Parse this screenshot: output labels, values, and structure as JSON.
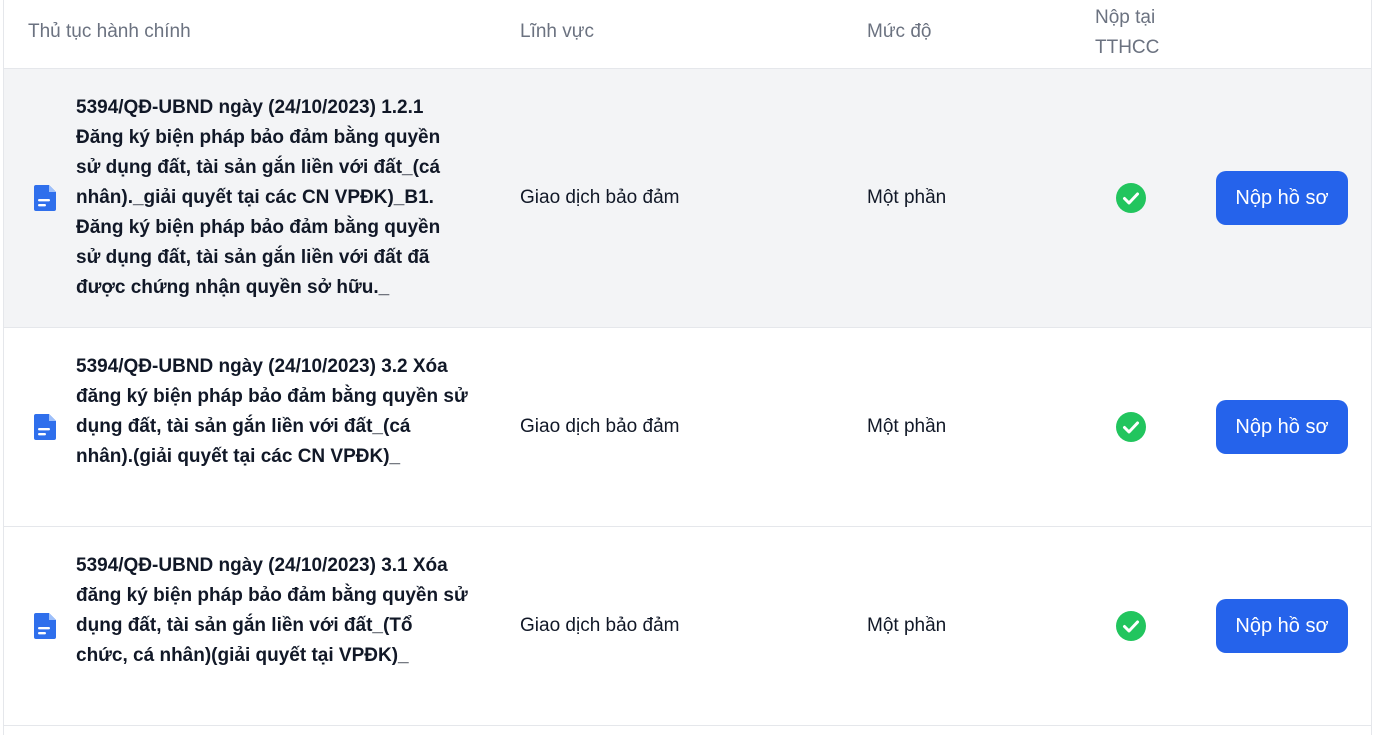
{
  "header": {
    "col_procedure": "Thủ tục hành chính",
    "col_field": "Lĩnh vực",
    "col_level": "Mức độ",
    "col_submit_at": "Nộp tại TTHCC"
  },
  "rows": [
    {
      "name": "5394/QĐ-UBND ngày (24/10/2023) 1.2.1 Đăng ký biện pháp bảo đảm bằng quyền sử dụng đất, tài sản gắn liền với đất_(cá nhân)._giải quyết tại các CN VPĐK)_B1. Đăng ký biện pháp bảo đảm bằng quyền sử dụng đất, tài sản gắn liền với đất đã được chứng nhận quyền sở hữu._",
      "field": "Giao dịch bảo đảm",
      "level": "Một phần",
      "submit_at_tthcc": true,
      "button": "Nộp hồ sơ"
    },
    {
      "name": "5394/QĐ-UBND ngày (24/10/2023) 3.2 Xóa đăng ký biện pháp bảo đảm bằng quyền sử dụng đất, tài sản gắn liền với đất_(cá nhân).(giải quyết tại các CN VPĐK)_",
      "field": "Giao dịch bảo đảm",
      "level": "Một phần",
      "submit_at_tthcc": true,
      "button": "Nộp hồ sơ"
    },
    {
      "name": "5394/QĐ-UBND ngày (24/10/2023) 3.1 Xóa đăng ký biện pháp bảo đảm bằng quyền sử dụng đất, tài sản gắn liền với đất_(Tổ chức, cá nhân)(giải quyết tại VPĐK)_",
      "field": "Giao dịch bảo đảm",
      "level": "Một phần",
      "submit_at_tthcc": true,
      "button": "Nộp hồ sơ"
    }
  ],
  "colors": {
    "accent": "#2563eb",
    "check": "#22c55e",
    "header_text": "#6b7280",
    "hover_row": "#f3f4f6"
  },
  "icons": [
    "document-icon",
    "check-circle-icon"
  ]
}
